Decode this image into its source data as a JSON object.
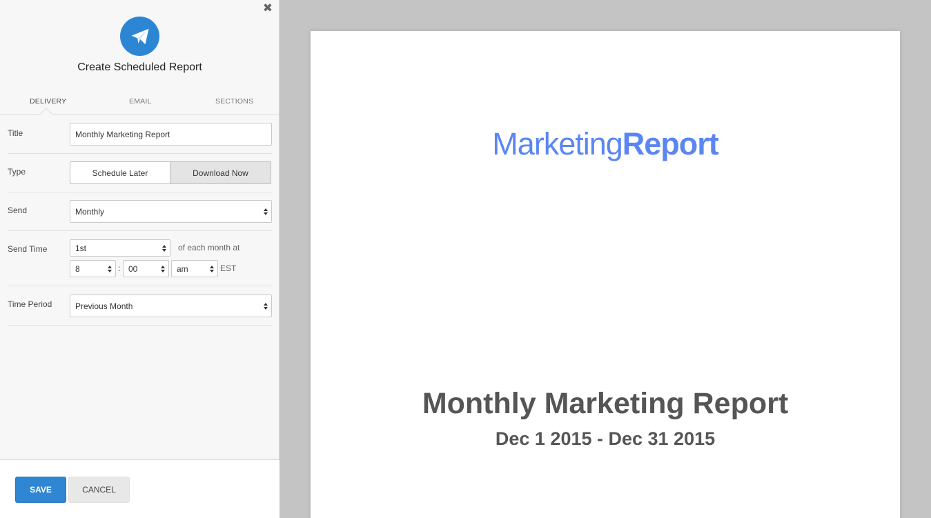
{
  "panel": {
    "title": "Create Scheduled Report",
    "close_glyph": "✖"
  },
  "tabs": [
    {
      "label": "DELIVERY",
      "active": true
    },
    {
      "label": "EMAIL",
      "active": false
    },
    {
      "label": "SECTIONS",
      "active": false
    }
  ],
  "form": {
    "title_label": "Title",
    "title_value": "Monthly Marketing Report",
    "type_label": "Type",
    "type_options": [
      "Schedule Later",
      "Download Now"
    ],
    "type_selected": "Download Now",
    "send_label": "Send",
    "send_value": "Monthly",
    "send_time_label": "Send Time",
    "day_value": "1st",
    "day_suffix": "of each month at",
    "hour_value": "8",
    "time_separator": ":",
    "minute_value": "00",
    "ampm_value": "am",
    "timezone": "EST",
    "time_period_label": "Time Period",
    "time_period_value": "Previous Month"
  },
  "footer": {
    "save_label": "SAVE",
    "cancel_label": "CANCEL"
  },
  "preview": {
    "brand_light": "Marketing",
    "brand_bold": "Report",
    "doc_title": "Monthly Marketing Report",
    "doc_range": "Dec 1 2015 - Dec 31 2015"
  },
  "colors": {
    "accent": "#2f86d2",
    "brand": "#5b86f2",
    "icon_circle": "#2d86d4"
  },
  "icons": {
    "logo": "paper-plane-icon",
    "close": "close-icon",
    "select": "select-arrows-icon"
  }
}
